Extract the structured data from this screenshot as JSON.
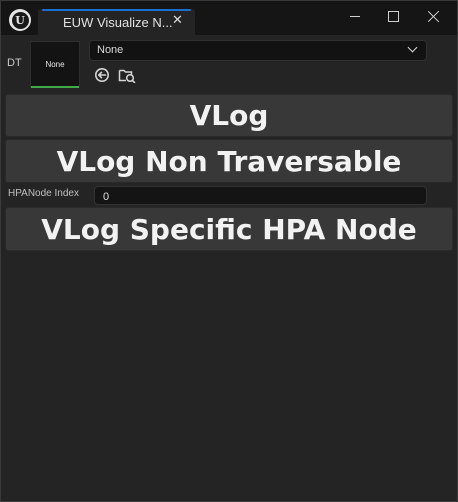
{
  "window": {
    "tab_title": "EUW Visualize N...",
    "tab_close": "✕"
  },
  "widget": {
    "dt_label": "DT",
    "asset_thumbnail_label": "None",
    "asset_combo_value": "None",
    "icons": [
      "use-selected-asset-icon",
      "browse-asset-icon"
    ]
  },
  "buttons": {
    "vlog": "VLog",
    "vlog_non_traversable": "VLog Non Traversable",
    "vlog_specific_hpa_node": "VLog Specific HPA Node"
  },
  "hpa_index": {
    "label": "HPANode Index",
    "value": "0"
  },
  "colors": {
    "tab_accent": "#1b6fd1",
    "thumbnail_bar": "#3faa46",
    "button_bg": "#383838",
    "panel_bg": "#242424"
  }
}
